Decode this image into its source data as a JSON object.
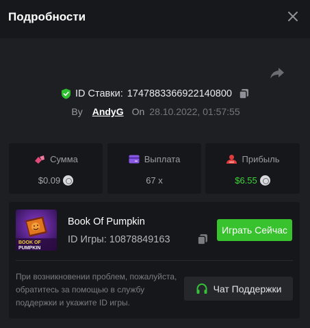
{
  "header": {
    "title": "Подробности",
    "close_icon": "close-icon"
  },
  "bet": {
    "id_label": "ID Ставки:",
    "id_value": "1747883366922140800",
    "by_label": "By",
    "user": "AndyG",
    "on_label": "On",
    "datetime": "28.10.2022, 01:57:55"
  },
  "stats": [
    {
      "label": "Сумма",
      "value": "$0.09",
      "icon": "bet-icon",
      "color": "#e14a78"
    },
    {
      "label": "Выплата",
      "value": "67 x",
      "icon": "card-icon",
      "color": "#8a58e6"
    },
    {
      "label": "Прибыль",
      "value": "$6.55",
      "icon": "user-money-icon",
      "color": "#e03c3c"
    }
  ],
  "game": {
    "name": "Book Of Pumpkin",
    "id_label": "ID Игры:",
    "id_value": "10878849163",
    "play_label": "Играть Сейчас",
    "thumb_text": [
      "BOOK OF",
      "PUMPKIN"
    ]
  },
  "help": {
    "text": "При возникновении проблем, пожалуйста, обратитесь за помощью в службу поддержки и укажите ID игры.",
    "support_label": "Чат Поддержки"
  },
  "colors": {
    "accent_green": "#38c22e",
    "profit_green": "#3cd43a",
    "background": "#1e1f23",
    "panel": "#16171a"
  }
}
